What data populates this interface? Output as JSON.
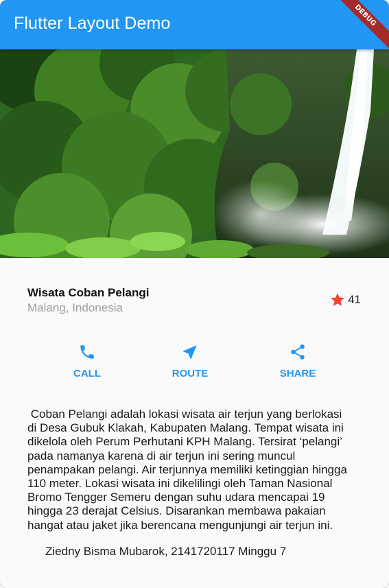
{
  "appbar": {
    "title": "Flutter Layout Demo",
    "debug_label": "DEBUG",
    "color": "#2196F3"
  },
  "hero": {
    "image": "waterfall-photo"
  },
  "place": {
    "title": "Wisata Coban Pelangi",
    "location": "Malang, Indonesia",
    "rating_count": "41",
    "star_color": "#F44336"
  },
  "actions": [
    {
      "label": "CALL",
      "icon": "phone-icon"
    },
    {
      "label": "ROUTE",
      "icon": "near-me-icon"
    },
    {
      "label": "SHARE",
      "icon": "share-icon"
    }
  ],
  "accent_color": "#2196F3",
  "description": " Coban Pelangi adalah lokasi wisata air terjun yang berlokasi\ndi Desa Gubuk Klakah, Kabupaten Malang. Tempat wisata ini\ndikelola oleh Perum Perhutani KPH Malang. Tersirat ‘pelangi’\npada namanya karena di air terjun ini sering muncul\npenampakan pelangi. Air terjunnya memiliki ketinggian hingga\n110 meter. Lokasi wisata ini dikelilingi oleh Taman Nasional\nBromo Tengger Semeru dengan suhu udara mencapai 19\nhingga 23 derajat Celsius. Disarankan membawa pakaian\nhangat atau jaket jika berencana mengunjungi air terjun ini.",
  "footer": "Ziedny Bisma Mubarok, 2141720117 Minggu 7"
}
